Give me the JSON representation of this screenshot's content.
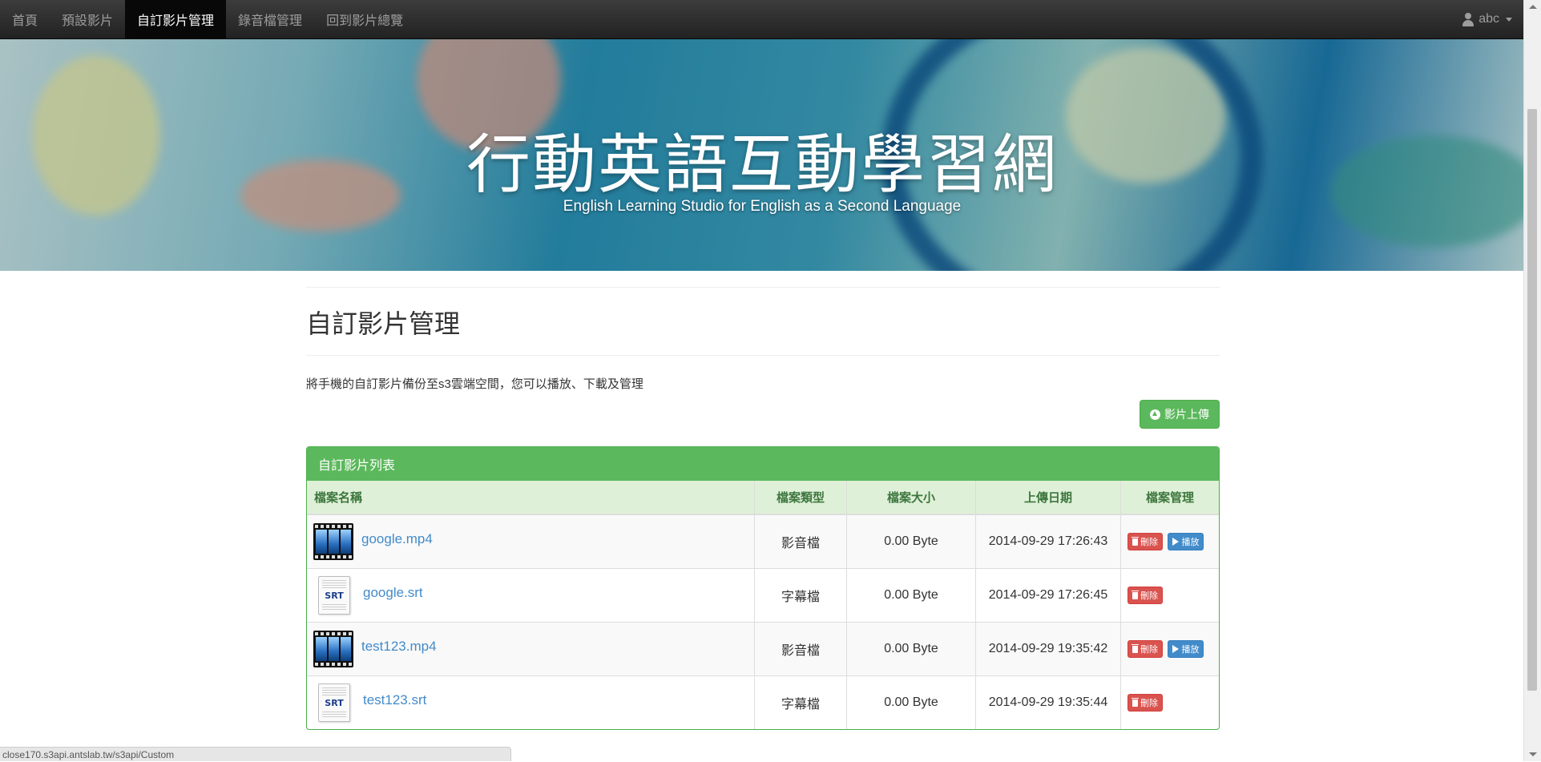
{
  "navbar": {
    "items": [
      {
        "label": "首頁"
      },
      {
        "label": "預設影片"
      },
      {
        "label": "自訂影片管理"
      },
      {
        "label": "錄音檔管理"
      },
      {
        "label": "回到影片總覽"
      }
    ],
    "active_index": 2,
    "user": {
      "name": "abc",
      "icon": "user-icon"
    }
  },
  "hero": {
    "title": "行動英語互動學習網",
    "subtitle": "English Learning Studio for English as a Second Language"
  },
  "main": {
    "page_title": "自訂影片管理",
    "description": "將手機的自訂影片備份至s3雲端空間，您可以播放、下載及管理",
    "upload_button": "影片上傳",
    "panel_title": "自訂影片列表",
    "table": {
      "headers": [
        "檔案名稱",
        "檔案類型",
        "檔案大小",
        "上傳日期",
        "檔案管理"
      ],
      "rows": [
        {
          "name": "google.mp4",
          "type": "影音檔",
          "size": "0.00 Byte",
          "date": "2014-09-29 17:26:43",
          "icon": "video-file-icon",
          "delete": "刪除",
          "play": "播放"
        },
        {
          "name": "google.srt",
          "type": "字幕檔",
          "size": "0.00 Byte",
          "date": "2014-09-29 17:26:45",
          "icon": "srt-file-icon",
          "delete": "刪除"
        },
        {
          "name": "test123.mp4",
          "type": "影音檔",
          "size": "0.00 Byte",
          "date": "2014-09-29 19:35:42",
          "icon": "video-file-icon",
          "delete": "刪除",
          "play": "播放"
        },
        {
          "name": "test123.srt",
          "type": "字幕檔",
          "size": "0.00 Byte",
          "date": "2014-09-29 19:35:44",
          "icon": "srt-file-icon",
          "delete": "刪除"
        }
      ]
    },
    "srt_icon_text": "SRT"
  },
  "statusbar": {
    "text": "close170.s3api.antslab.tw/s3api/Custom"
  },
  "colors": {
    "navbar": "#222222",
    "success": "#5cb85c",
    "danger": "#d9534f",
    "primary": "#428bca",
    "link": "#428bca"
  }
}
